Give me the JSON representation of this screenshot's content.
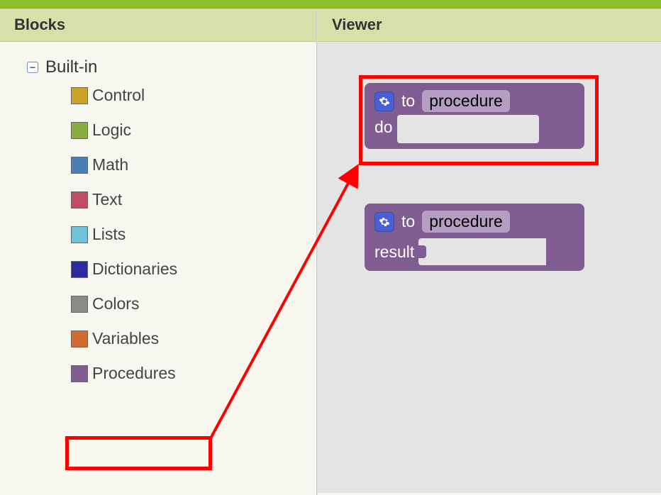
{
  "panels": {
    "blocks_title": "Blocks",
    "viewer_title": "Viewer"
  },
  "tree": {
    "root_label": "Built-in",
    "items": [
      {
        "label": "Control",
        "color": "#c9a227"
      },
      {
        "label": "Logic",
        "color": "#8aad3f"
      },
      {
        "label": "Math",
        "color": "#4a7fb5"
      },
      {
        "label": "Text",
        "color": "#c14a64"
      },
      {
        "label": "Lists",
        "color": "#6fc3d9"
      },
      {
        "label": "Dictionaries",
        "color": "#2b2a9e"
      },
      {
        "label": "Colors",
        "color": "#8a8a8a"
      },
      {
        "label": "Variables",
        "color": "#d66a2e"
      },
      {
        "label": "Procedures",
        "color": "#7f5c91"
      }
    ]
  },
  "blocks": {
    "to_label": "to",
    "do_label": "do",
    "result_label": "result",
    "procedure_name": "procedure"
  }
}
